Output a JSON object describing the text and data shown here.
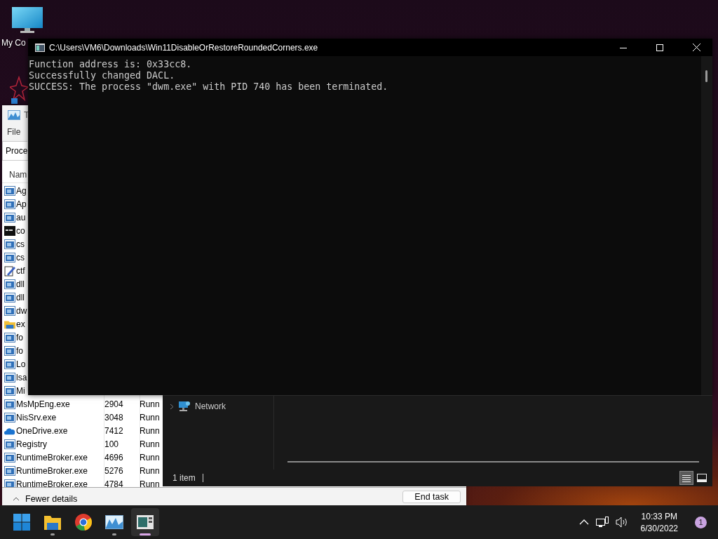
{
  "desktop": {
    "icons": [
      {
        "label": "My Co"
      }
    ]
  },
  "task_manager": {
    "title": "T",
    "menu": [
      "File"
    ],
    "tabs": [
      {
        "label": "Proce",
        "selected": true
      }
    ],
    "columns": [
      "Nam"
    ],
    "rows": [
      {
        "kind": "app",
        "name": "Ag"
      },
      {
        "kind": "app",
        "name": "Ap"
      },
      {
        "kind": "app",
        "name": "au"
      },
      {
        "kind": "console",
        "name": "co"
      },
      {
        "kind": "app",
        "name": "cs"
      },
      {
        "kind": "app",
        "name": "cs"
      },
      {
        "kind": "notepad",
        "name": "ctf"
      },
      {
        "kind": "app",
        "name": "dll"
      },
      {
        "kind": "app",
        "name": "dll"
      },
      {
        "kind": "app",
        "name": "dw"
      },
      {
        "kind": "folder",
        "name": "ex"
      },
      {
        "kind": "app",
        "name": "fo"
      },
      {
        "kind": "app",
        "name": "fo"
      },
      {
        "kind": "app",
        "name": "Lo"
      },
      {
        "kind": "app",
        "name": "lsa"
      },
      {
        "kind": "app",
        "name": "Mi"
      },
      {
        "kind": "app",
        "name": "MsMpEng.exe",
        "pid": "2904",
        "status": "Runn"
      },
      {
        "kind": "app",
        "name": "NisSrv.exe",
        "pid": "3048",
        "status": "Runn"
      },
      {
        "kind": "cloud",
        "name": "OneDrive.exe",
        "pid": "7412",
        "status": "Runn"
      },
      {
        "kind": "app",
        "name": "Registry",
        "pid": "100",
        "status": "Runn"
      },
      {
        "kind": "app",
        "name": "RuntimeBroker.exe",
        "pid": "4696",
        "status": "Runn"
      },
      {
        "kind": "app",
        "name": "RuntimeBroker.exe",
        "pid": "5276",
        "status": "Runn"
      },
      {
        "kind": "app",
        "name": "RuntimeBroker.exe",
        "pid": "4784",
        "status": "Runn"
      }
    ],
    "toggle": "Fewer details",
    "button": "End task"
  },
  "console_window": {
    "title": "C:\\Users\\VM6\\Downloads\\Win11DisableOrRestoreRoundedCorners.exe",
    "lines": [
      "Function address is: 0x33cc8.",
      "Successfully changed DACL.",
      "SUCCESS: The process \"dwm.exe\" with PID 740 has been terminated."
    ]
  },
  "explorer": {
    "nav_items": [
      {
        "label": "Network",
        "expanded": false
      }
    ],
    "status": "1 item",
    "views": [
      {
        "kind": "details",
        "selected": true
      },
      {
        "kind": "tiles",
        "selected": false
      }
    ]
  },
  "taskbar": {
    "apps": [
      {
        "kind": "start",
        "running": false,
        "selected": false
      },
      {
        "kind": "folder",
        "running": true,
        "selected": false
      },
      {
        "kind": "browser",
        "running": false,
        "selected": false
      },
      {
        "kind": "chart",
        "running": true,
        "selected": false
      },
      {
        "kind": "terminal",
        "running": true,
        "selected": true
      }
    ],
    "time": "10:33 PM",
    "date": "6/30/2022",
    "notifications": "1"
  }
}
